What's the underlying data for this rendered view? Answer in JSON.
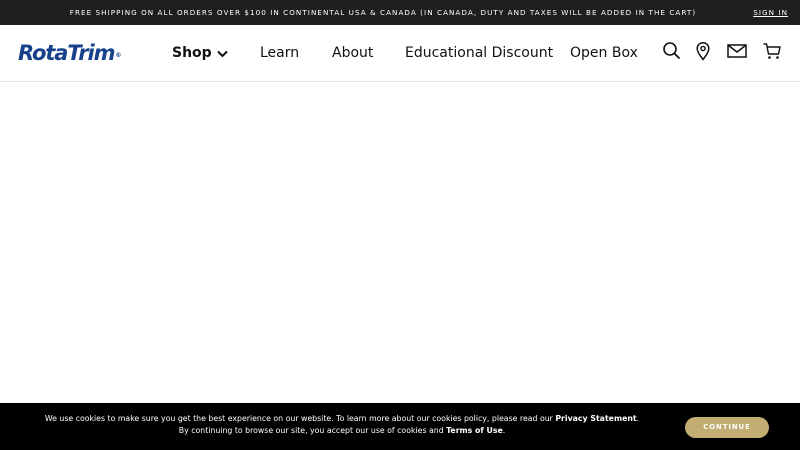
{
  "topbar": {
    "promo": "FREE SHIPPING ON ALL ORDERS OVER $100 IN CONTINENTAL USA & CANADA (IN CANADA, DUTY AND TAXES WILL BE ADDED IN THE CART)",
    "sign_in": "SIGN IN"
  },
  "header": {
    "logo_text": "RotaTrim",
    "logo_mark": "®",
    "nav": {
      "shop": "Shop",
      "learn": "Learn",
      "about": "About",
      "educational_discount": "Educational Discount",
      "open_box": "Open Box"
    },
    "icons": [
      "search-icon",
      "location-icon",
      "mail-icon",
      "cart-icon"
    ]
  },
  "cookie_banner": {
    "text_1": "We use cookies to make sure you get the best experience on our website. To learn more about our cookies policy, please read our ",
    "privacy_link": "Privacy Statement",
    "text_2": ". By continuing to browse our site, you accept our use of cookies and ",
    "terms_link": "Terms of Use",
    "text_3": ".",
    "continue_label": "CONTINUE"
  },
  "colors": {
    "topbar_bg": "#1e1f21",
    "brand_blue": "#17428b",
    "cookie_bg": "#000000",
    "continue_bg": "#c2ad72"
  }
}
